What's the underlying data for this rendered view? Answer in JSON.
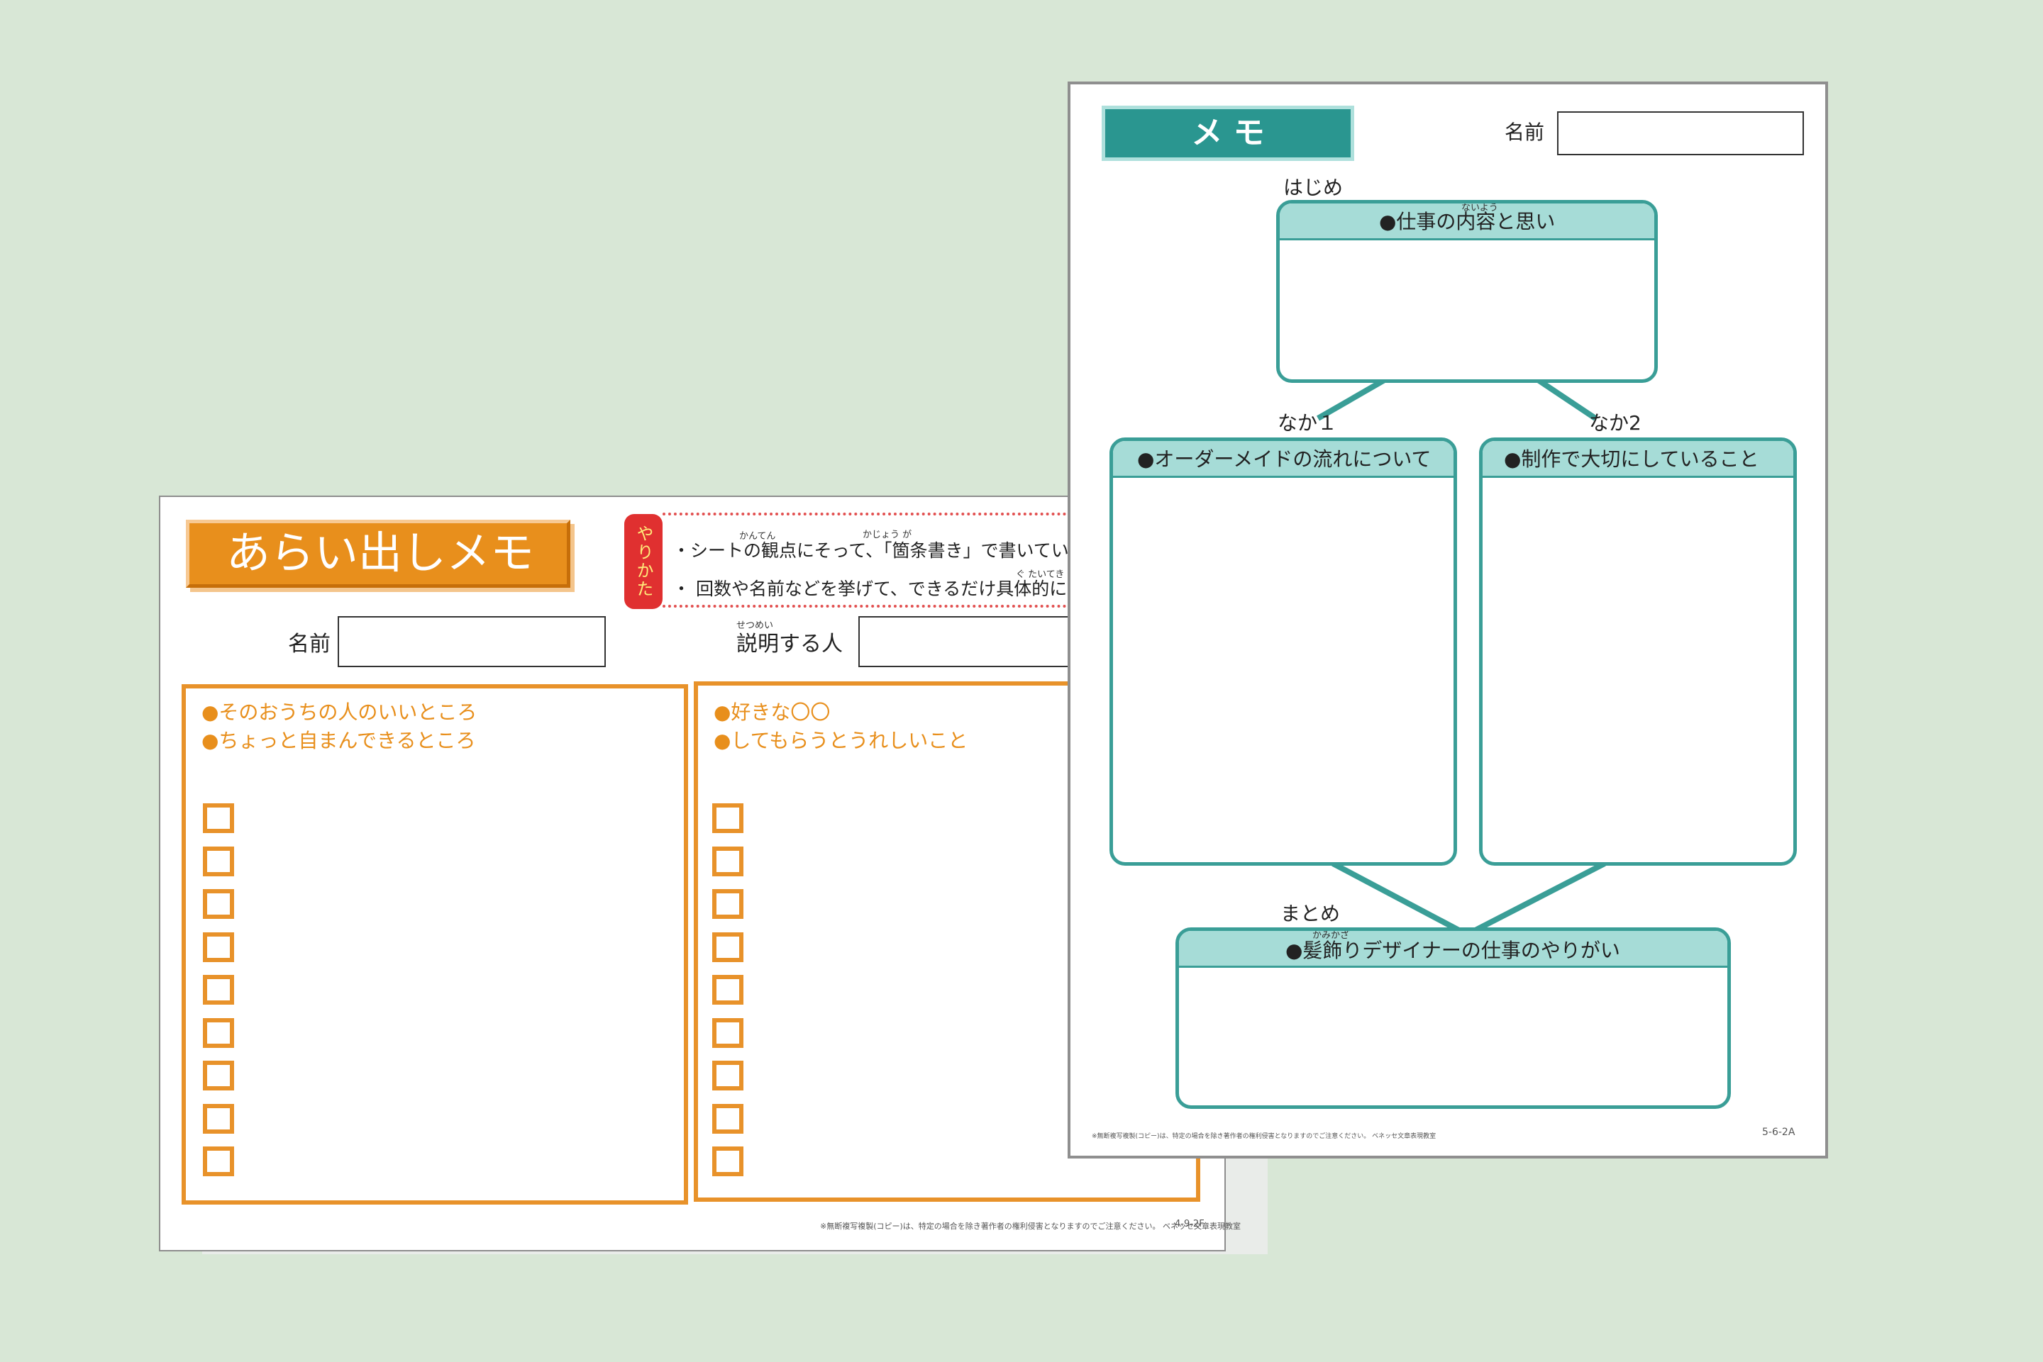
{
  "left_sheet": {
    "title": "あらい出しメモ",
    "howto_tag": "やりかた",
    "instructions": [
      "・シートの観点にそって、「箇条書き」で書いていきます。",
      "・ 回数や名前などを挙げて、できるだけ具体的に"
    ],
    "ruby": {
      "kanten": "かんてん",
      "kajougaki": "かじょう が",
      "gutaiteki": "ぐ たいてき",
      "setsumei": "せつめい"
    },
    "name_label": "名前",
    "explainer_label": "説明する人",
    "box1": {
      "items": [
        "●そのおうちの人のいいところ",
        "●ちょっと自まんできるところ"
      ],
      "checkbox_count": 9
    },
    "box2": {
      "items": [
        "●好きな〇〇",
        "●してもらうとうれしいこと"
      ],
      "checkbox_count": 9
    },
    "footer_note": "※無断複写複製(コピー)は、特定の場合を除き著作者の権利侵害となりますのでご注意ください。 ベネッセ文章表現教室",
    "page_code": "4-9-2F"
  },
  "right_sheet": {
    "title": "メ モ",
    "name_label": "名前",
    "hajime": {
      "label": "はじめ",
      "heading": "●仕事の内容と思い",
      "ruby": "ないよう"
    },
    "naka1": {
      "label": "なか１",
      "heading": "●オーダーメイドの流れについて"
    },
    "naka2": {
      "label": "なか2",
      "heading": "●制作で大切にしていること"
    },
    "matome": {
      "label": "まとめ",
      "heading": "●髪飾りデザイナーの仕事のやりがい",
      "ruby": "かみかざ"
    },
    "footer_note": "※無断複写複製(コピー)は、特定の場合を除き著作者の権利侵害となりますのでご注意ください。 ベネッセ文章表現教室",
    "page_code": "5-6-2A"
  },
  "colors": {
    "background": "#d8e7d6",
    "orange": "#e88f1c",
    "teal": "#2a9690",
    "teal_light": "#a6dcd7",
    "red_tag": "#e03030"
  }
}
